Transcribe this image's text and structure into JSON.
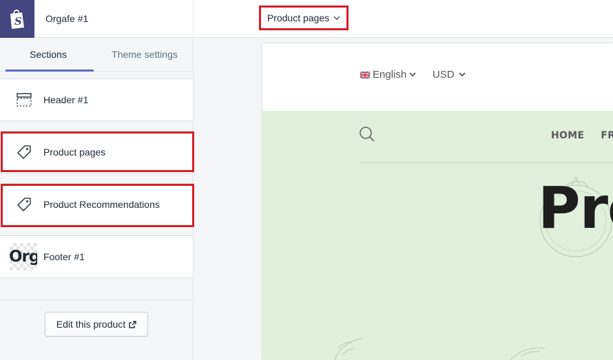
{
  "sidebar": {
    "store_name": "Orgafe #1",
    "tabs": [
      {
        "label": "Sections",
        "active": true
      },
      {
        "label": "Theme settings",
        "active": false
      }
    ],
    "sections": [
      {
        "label": "Header #1",
        "icon": "header-layout-icon"
      },
      {
        "label": "Product pages",
        "icon": "tag-icon",
        "highlighted": true
      },
      {
        "label": "Product Recommendations",
        "icon": "tag-icon",
        "highlighted": true
      },
      {
        "label": "Footer #1",
        "icon": "footer-logo-thumbnail"
      }
    ],
    "footer_thumbnail_text": "Org",
    "edit_button_label": "Edit this product"
  },
  "topbar": {
    "page_selector_label": "Product pages"
  },
  "preview": {
    "language": "English",
    "currency": "USD",
    "nav_items": [
      "HOME",
      "FRU"
    ],
    "title": "Pro"
  },
  "colors": {
    "brand": "#43467f",
    "tab_active": "#5c6ac4",
    "highlight": "#d21f26",
    "preview_green": "#e0f0db"
  }
}
